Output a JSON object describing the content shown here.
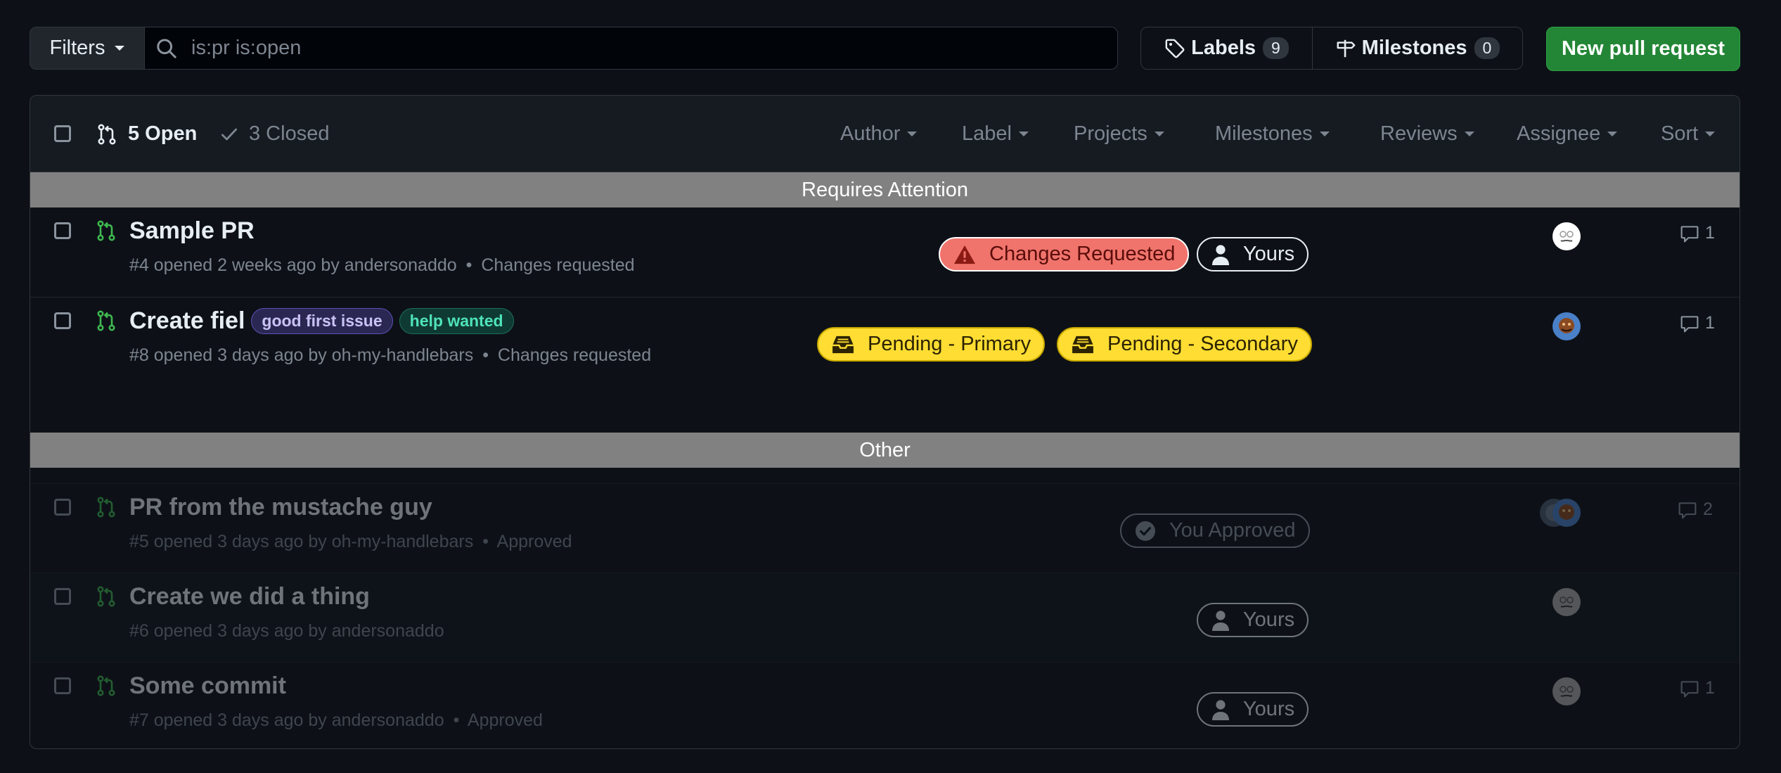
{
  "toolbar": {
    "filters_label": "Filters",
    "search_value": "is:pr is:open",
    "labels_label": "Labels",
    "labels_count": "9",
    "milestones_label": "Milestones",
    "milestones_count": "0",
    "new_pr_label": "New pull request"
  },
  "list_header": {
    "open_label": "5 Open",
    "closed_label": "3 Closed",
    "filters": [
      "Author",
      "Label",
      "Projects",
      "Milestones",
      "Reviews",
      "Assignee",
      "Sort"
    ]
  },
  "sections": {
    "attention": "Requires Attention",
    "other": "Other"
  },
  "prs": [
    {
      "title": "Sample PR",
      "meta": "#4 opened 2 weeks ago by andersonaddo",
      "status": "Changes requested",
      "labels": [],
      "badges": [
        "Changes Requested",
        "Yours"
      ],
      "comments": "1"
    },
    {
      "title": "Create fiel",
      "meta": "#8 opened 3 days ago by oh-my-handlebars",
      "status": "Changes requested",
      "labels": [
        "good first issue",
        "help wanted"
      ],
      "badges": [
        "Pending - Primary",
        "Pending - Secondary"
      ],
      "comments": "1"
    },
    {
      "title": "PR from the mustache guy",
      "meta": "#5 opened 3 days ago by oh-my-handlebars",
      "status": "Approved",
      "labels": [],
      "badges": [
        "You Approved"
      ],
      "comments": "2"
    },
    {
      "title": "Create we did a thing",
      "meta": "#6 opened 3 days ago by andersonaddo",
      "status": "",
      "labels": [],
      "badges": [
        "Yours"
      ],
      "comments": ""
    },
    {
      "title": "Some commit",
      "meta": "#7 opened 3 days ago by andersonaddo",
      "status": "Approved",
      "labels": [],
      "badges": [
        "Yours"
      ],
      "comments": "1"
    }
  ],
  "separator": "•",
  "colors": {
    "background": "#0d1117",
    "header_bg": "#161b22",
    "section_bar": "#818181",
    "primary_button": "#238636",
    "open_icon": "#3fb950",
    "changes_requested_pill": "#f0746c",
    "pending_pill": "#ffdd33"
  },
  "icons": [
    "search-icon",
    "tag-icon",
    "milestone-icon",
    "pull-request-icon",
    "check-icon",
    "alert-icon",
    "person-icon",
    "inbox-icon",
    "check-circle-icon",
    "comment-icon"
  ]
}
